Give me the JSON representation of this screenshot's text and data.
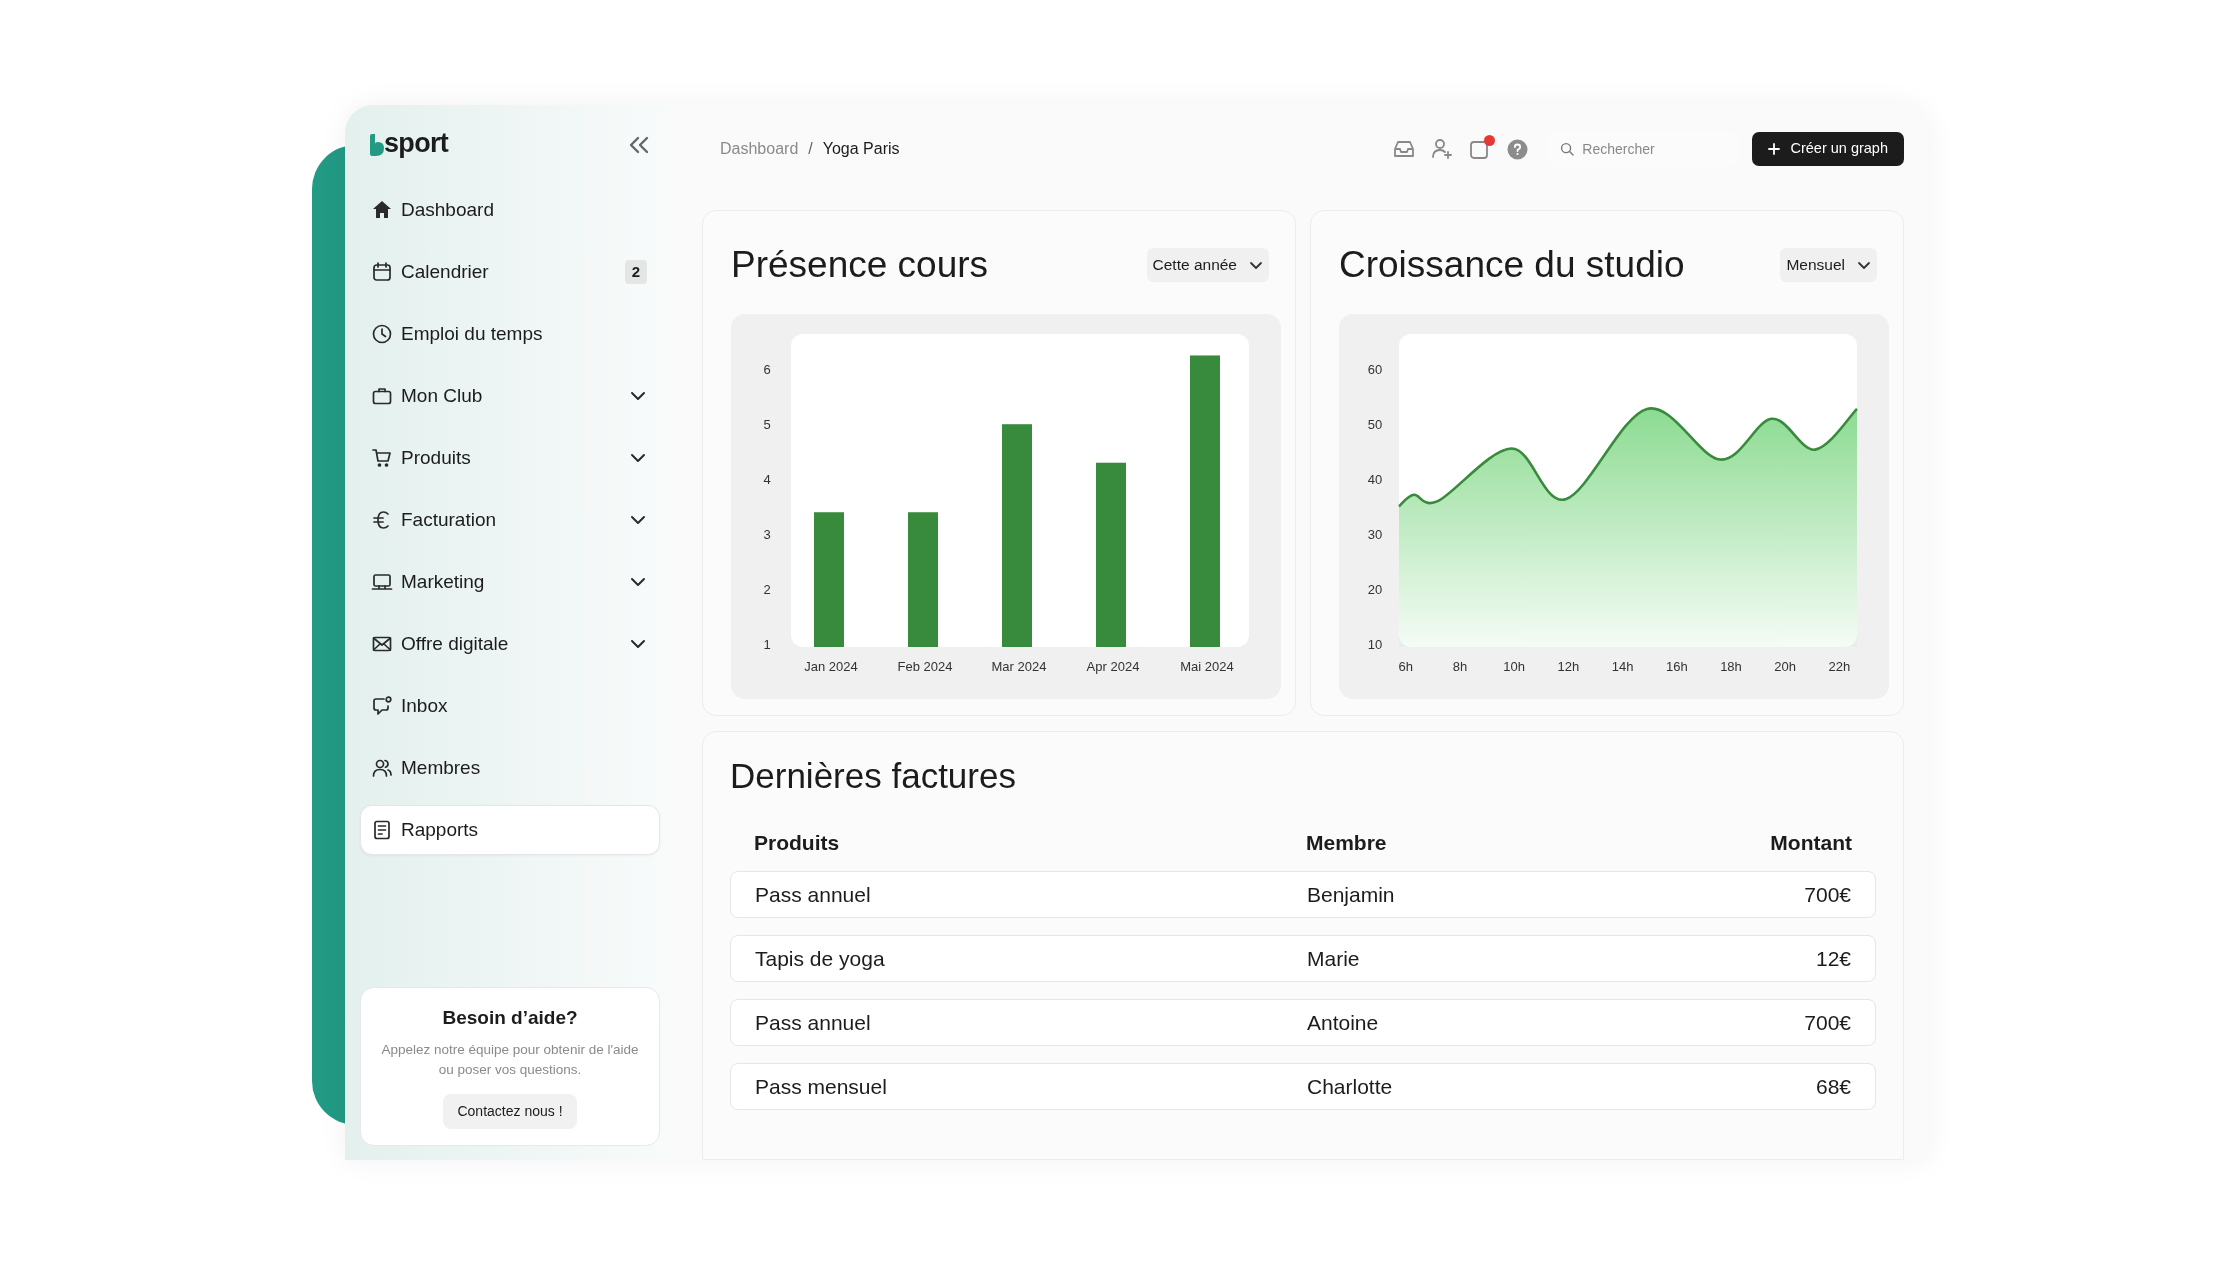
{
  "sidebar": {
    "logo": "sport",
    "items": [
      {
        "label": "Dashboard",
        "kind": "link",
        "selected": false
      },
      {
        "label": "Calendrier",
        "kind": "link",
        "selected": false,
        "badge": "2"
      },
      {
        "label": "Emploi du temps",
        "kind": "link",
        "selected": false
      },
      {
        "label": "Mon Club",
        "kind": "group",
        "selected": false,
        "expanded": false
      },
      {
        "label": "Produits",
        "kind": "group",
        "selected": false,
        "expanded": false
      },
      {
        "label": "Facturation",
        "kind": "group",
        "selected": false,
        "expanded": false
      },
      {
        "label": "Marketing",
        "kind": "group",
        "selected": false,
        "expanded": false
      },
      {
        "label": "Offre digitale",
        "kind": "group",
        "selected": false,
        "expanded": false
      },
      {
        "label": "Inbox",
        "kind": "link",
        "selected": false
      },
      {
        "label": "Membres",
        "kind": "link",
        "selected": false
      },
      {
        "label": "Rapports",
        "kind": "link",
        "selected": true
      }
    ],
    "help": {
      "title": "Besoin d’aide?",
      "text": "Appelez notre équipe pour obtenir de l'aide ou poser vos questions.",
      "button": "Contactez nous !"
    }
  },
  "topbar": {
    "breadcrumbs": [
      "Dashboard",
      "Yoga Paris"
    ],
    "breadcrumb_separator": "/",
    "notification_unread": true,
    "search": {
      "placeholder": "Rechercher"
    },
    "button": "Créer un graph"
  },
  "cards": [
    {
      "title": "Présence cours",
      "filter": "Cette année",
      "chart_data": {
        "type": "bar",
        "categories": [
          "Jan 2024",
          "Feb 2024",
          "Mar 2024",
          "Apr 2024",
          "Mai 2024"
        ],
        "series": [
          {
            "color": "#388a3c",
            "values": [
              3.4,
              3.4,
              5.0,
              4.3,
              6.25
            ]
          }
        ],
        "ylim": [
          0.95,
          6.64
        ],
        "yticks": [
          1,
          2,
          3,
          4,
          5,
          6
        ]
      }
    },
    {
      "title": "Croissance du studio",
      "filter": "Mensuel",
      "chart_data": {
        "type": "area",
        "x": [
          5.75,
          6.3,
          7.2,
          9.9,
          11.9,
          14.9,
          17.6,
          19.5,
          21.1,
          22.65
        ],
        "series": [
          {
            "color": "#388a3c",
            "values": [
              35,
              37.1,
              36,
              45.5,
              36.3,
              52.7,
              43.5,
              50.9,
              45.3,
              52.7
            ]
          }
        ],
        "xlim": [
          5.75,
          22.65
        ],
        "ylim": [
          9.46,
          66.3
        ],
        "xticks": [
          {
            "value": 6,
            "label": "6h"
          },
          {
            "value": 8,
            "label": "8h"
          },
          {
            "value": 10,
            "label": "10h"
          },
          {
            "value": 12,
            "label": "12h"
          },
          {
            "value": 14,
            "label": "14h"
          },
          {
            "value": 16,
            "label": "16h"
          },
          {
            "value": 18,
            "label": "18h"
          },
          {
            "value": 20,
            "label": "20h"
          },
          {
            "value": 22,
            "label": "22h"
          }
        ],
        "yticks": [
          10,
          20,
          30,
          40,
          50,
          60
        ]
      }
    }
  ],
  "invoices": {
    "title": "Dernières factures",
    "columns": [
      "Produits",
      "Membre",
      "Montant"
    ],
    "rows": [
      [
        "Pass annuel",
        "Benjamin",
        "700€"
      ],
      [
        "Tapis de yoga",
        "Marie",
        "12€"
      ],
      [
        "Pass annuel",
        "Antoine",
        "700€"
      ],
      [
        "Pass mensuel",
        "Charlotte",
        "68€"
      ]
    ]
  }
}
